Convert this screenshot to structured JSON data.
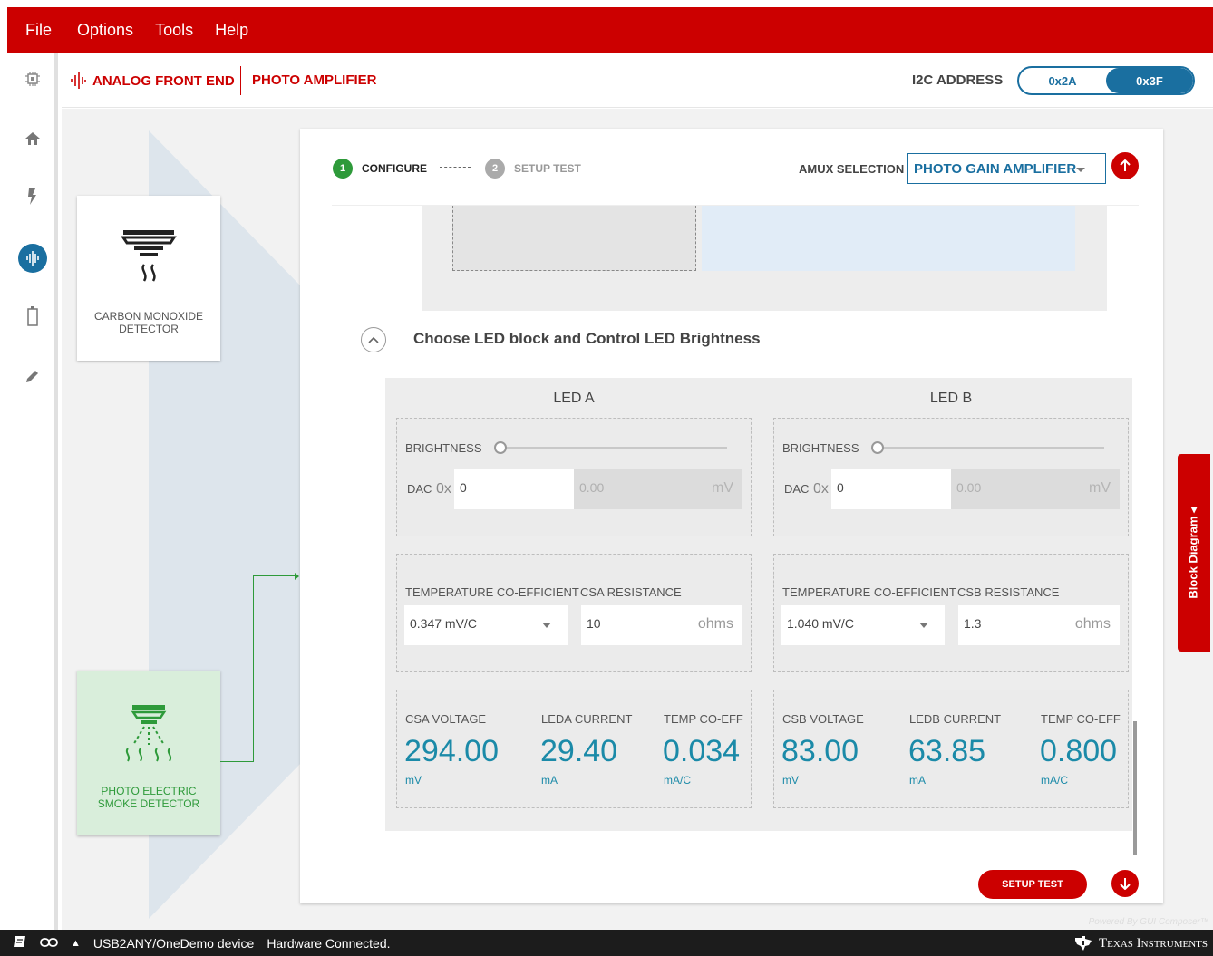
{
  "menu": {
    "items": [
      "File",
      "Options",
      "Tools",
      "Help"
    ]
  },
  "sidebar": {
    "icons": [
      "chip-icon",
      "home-icon",
      "lightning-icon",
      "waveform-icon",
      "battery-icon",
      "pencil-icon"
    ]
  },
  "header": {
    "crumb1": "ANALOG FRONT END",
    "crumb2": "PHOTO AMPLIFIER",
    "i2c_label": "I2C ADDRESS",
    "i2c_options": [
      "0x2A",
      "0x3F"
    ],
    "i2c_selected": "0x3F"
  },
  "devices": {
    "co": {
      "line1": "CARBON MONOXIDE",
      "line2": "DETECTOR"
    },
    "smoke": {
      "line1": "PHOTO ELECTRIC",
      "line2": "SMOKE DETECTOR"
    }
  },
  "wizard": {
    "step1_num": "1",
    "step1_label": "CONFIGURE",
    "step2_num": "2",
    "step2_label": "SETUP TEST",
    "amux_label": "AMUX SELECTION",
    "amux_value": "PHOTO GAIN AMPLIFIER"
  },
  "section": {
    "title": "Choose LED block and Control LED Brightness"
  },
  "led_a": {
    "title": "LED A",
    "brightness_label": "BRIGHTNESS",
    "brightness_level": 0,
    "dac_label": "DAC",
    "dac_prefix": "0x",
    "dac_value": "0",
    "mv_value": "0.00",
    "mv_unit": "mV",
    "tc_label": "TEMPERATURE CO-EFFICIENT",
    "tc_value": "0.347 mV/C",
    "res_label": "CSA RESISTANCE",
    "res_value": "10",
    "res_unit": "ohms",
    "readouts": [
      {
        "label": "CSA VOLTAGE",
        "value": "294.00",
        "unit": "mV"
      },
      {
        "label": "LEDA CURRENT",
        "value": "29.40",
        "unit": "mA"
      },
      {
        "label": "TEMP CO-EFF",
        "value": "0.034",
        "unit": "mA/C"
      }
    ]
  },
  "led_b": {
    "title": "LED B",
    "brightness_label": "BRIGHTNESS",
    "brightness_level": 0,
    "dac_label": "DAC",
    "dac_prefix": "0x",
    "dac_value": "0",
    "mv_value": "0.00",
    "mv_unit": "mV",
    "tc_label": "TEMPERATURE CO-EFFICIENT",
    "tc_value": "1.040 mV/C",
    "res_label": "CSB RESISTANCE",
    "res_value": "1.3",
    "res_unit": "ohms",
    "readouts": [
      {
        "label": "CSB VOLTAGE",
        "value": "83.00",
        "unit": "mV"
      },
      {
        "label": "LEDB CURRENT",
        "value": "63.85",
        "unit": "mA"
      },
      {
        "label": "TEMP CO-EFF",
        "value": "0.800",
        "unit": "mA/C"
      }
    ]
  },
  "buttons": {
    "setup_test": "SETUP TEST",
    "block_diagram": "Block Diagram ◂"
  },
  "footer": {
    "powered": "Powered By GUI Composer™",
    "device": "USB2ANY/OneDemo device",
    "status": "Hardware Connected.",
    "brand": "Texas Instruments"
  },
  "colors": {
    "brand_red": "#cc0000",
    "accent_blue": "#1a6fa0",
    "value_teal": "#1b8aa8",
    "success_green": "#2e9a3a"
  }
}
